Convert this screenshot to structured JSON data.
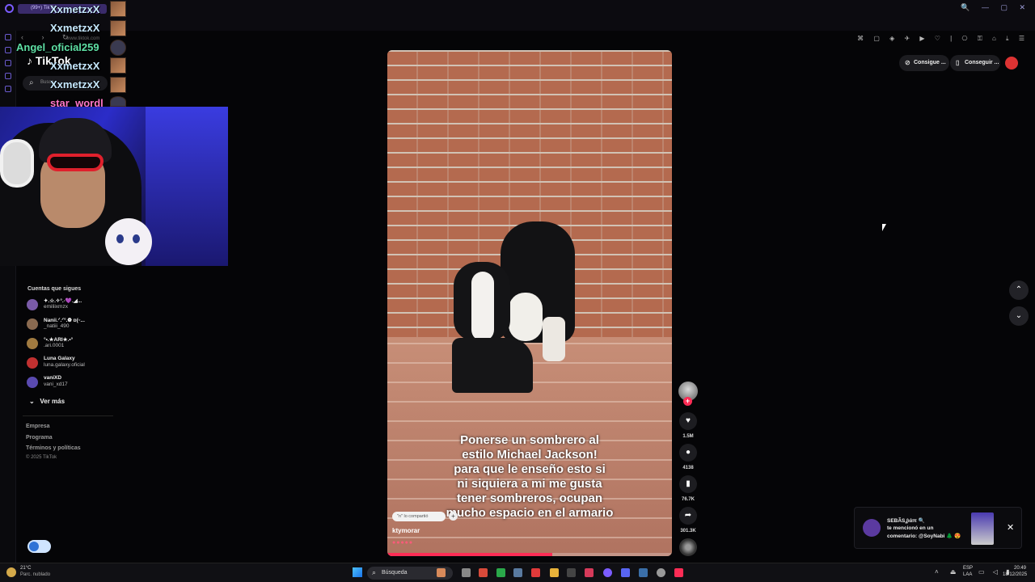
{
  "browser": {
    "tab_label": "(99+) TikTok",
    "url": "www.tiktok.com"
  },
  "chat": [
    {
      "name": "XxmetzxX",
      "color": "#c7e9ff"
    },
    {
      "name": "XxmetzxX",
      "color": "#c7e9ff"
    },
    {
      "name": "Angel_oficial259",
      "color": "#5ee0a5"
    },
    {
      "name": "XxmetzxX",
      "color": "#c7e9ff"
    },
    {
      "name": "XxmetzxX",
      "color": "#c7e9ff"
    },
    {
      "name": "star_wordl",
      "color": "#ff77c8"
    }
  ],
  "tiktok": {
    "logo": "TikTok",
    "search_placeholder": "Busca"
  },
  "sidebar": {
    "following_title": "Cuentas que sigues",
    "accounts": [
      {
        "name": "✦.☆.✧°.·💜.◢...",
        "handle": "emiliixmzx",
        "avatar_color": "#7a5ba8"
      },
      {
        "name": "Nanii.ᐟ.ᐟ°.❁ ɒ(ᵕ...",
        "handle": "_natiii_490",
        "avatar_color": "#8a6a50"
      },
      {
        "name": "°•.★ARI★.•°",
        "handle": ".ari.0001",
        "avatar_color": "#a07a40"
      },
      {
        "name": "Luna Galaxy",
        "handle": "luna.galaxy.oficial",
        "avatar_color": "#c03030"
      },
      {
        "name": "vaniXD",
        "handle": "vani_xd17",
        "avatar_color": "#5a4ab0"
      }
    ],
    "see_more": "Ver más",
    "footer_links": [
      "Empresa",
      "Programa",
      "Términos y políticas"
    ],
    "copyright": "© 2025 TikTok"
  },
  "video": {
    "caption_lines": [
      "Ponerse un sombrero al",
      "estilo Michael Jackson!",
      "para que le enseño esto si",
      "ni siquiera a mi me gusta",
      "tener sombreros, ocupan",
      "mucho espacio en el armario"
    ],
    "shared_label": "\"n\" lo compartió",
    "author": "ktymorar",
    "emojis": "●●●●●",
    "progress": 0.58
  },
  "actions": {
    "likes": "1.5M",
    "comments": "4138",
    "saves": "76.7K",
    "shares": "301.3K"
  },
  "header_buttons": {
    "get_coins": "Consigue ...",
    "get_app": "Conseguir ..."
  },
  "notification": {
    "user": "SEBÃSʆιἀπ 🔍",
    "line2": "te mencionó en un",
    "line3": "comentario: @SoyNabi 🌲 😍"
  },
  "taskbar": {
    "temp": "21°C",
    "weather": "Parc. nublado",
    "search": "Búsqueda",
    "lang1": "ESP",
    "lang2": "LAA",
    "time": "20:49",
    "date": "18/12/2025"
  },
  "colors": {
    "accent": "#fe2c55",
    "browser_accent": "#7b5cff"
  }
}
